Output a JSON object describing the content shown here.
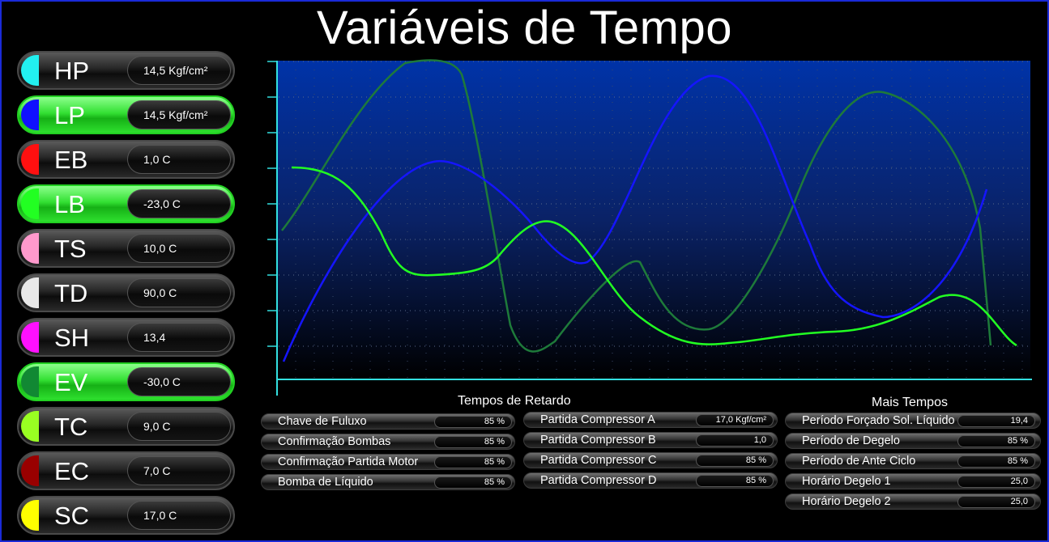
{
  "title": "Variáveis de Tempo",
  "colors": {
    "active_green": "#33e033",
    "series_blue": "#1515ff",
    "series_green": "#22ff22",
    "series_dark_green": "#1e7a3a",
    "axis_cyan": "#33e0e0"
  },
  "sensors": [
    {
      "label": "HP",
      "value": "14,5 Kgf/cm²",
      "color": "#22f0f0",
      "active": false
    },
    {
      "label": "LP",
      "value": "14,5 Kgf/cm²",
      "color": "#1010ff",
      "active": true
    },
    {
      "label": "EB",
      "value": "1,0 C",
      "color": "#ff1010",
      "active": false
    },
    {
      "label": "LB",
      "value": "-23,0 C",
      "color": "#22ff22",
      "active": true
    },
    {
      "label": "TS",
      "value": "10,0 C",
      "color": "#ff99cc",
      "active": false
    },
    {
      "label": "TD",
      "value": "90,0 C",
      "color": "#e8e8e8",
      "active": false
    },
    {
      "label": "SH",
      "value": "13,4",
      "color": "#ff10ff",
      "active": false
    },
    {
      "label": "EV",
      "value": "-30,0 C",
      "color": "#118833",
      "active": true
    },
    {
      "label": "TC",
      "value": "9,0 C",
      "color": "#99ff22",
      "active": false
    },
    {
      "label": "EC",
      "value": "7,0 C",
      "color": "#990000",
      "active": false
    },
    {
      "label": "SC",
      "value": "17,0 C",
      "color": "#ffff00",
      "active": false
    }
  ],
  "retardo": {
    "title": "Tempos de Retardo",
    "col1": [
      {
        "label": "Chave de Fuluxo",
        "value": "85 %"
      },
      {
        "label": "Confirmação Bombas",
        "value": "85 %"
      },
      {
        "label": "Confirmação Partida Motor",
        "value": "85 %"
      },
      {
        "label": "Bomba de Líquido",
        "value": "85 %"
      }
    ],
    "col2": [
      {
        "label": "Partida Compressor A",
        "value": "17,0 Kgf/cm²"
      },
      {
        "label": "Partida Compressor B",
        "value": "1,0"
      },
      {
        "label": "Partida Compressor C",
        "value": "85 %"
      },
      {
        "label": "Partida Compressor D",
        "value": "85 %"
      }
    ]
  },
  "mais": {
    "title": "Mais Tempos",
    "items": [
      {
        "label": "Período Forçado Sol. Líquido",
        "value": "19,4"
      },
      {
        "label": "Período de Degelo",
        "value": "85 %"
      },
      {
        "label": "Período de Ante Ciclo",
        "value": "85 %"
      },
      {
        "label": "Horário Degelo 1",
        "value": "25,0"
      },
      {
        "label": "Horário Degelo 2",
        "value": "25,0"
      }
    ]
  }
}
